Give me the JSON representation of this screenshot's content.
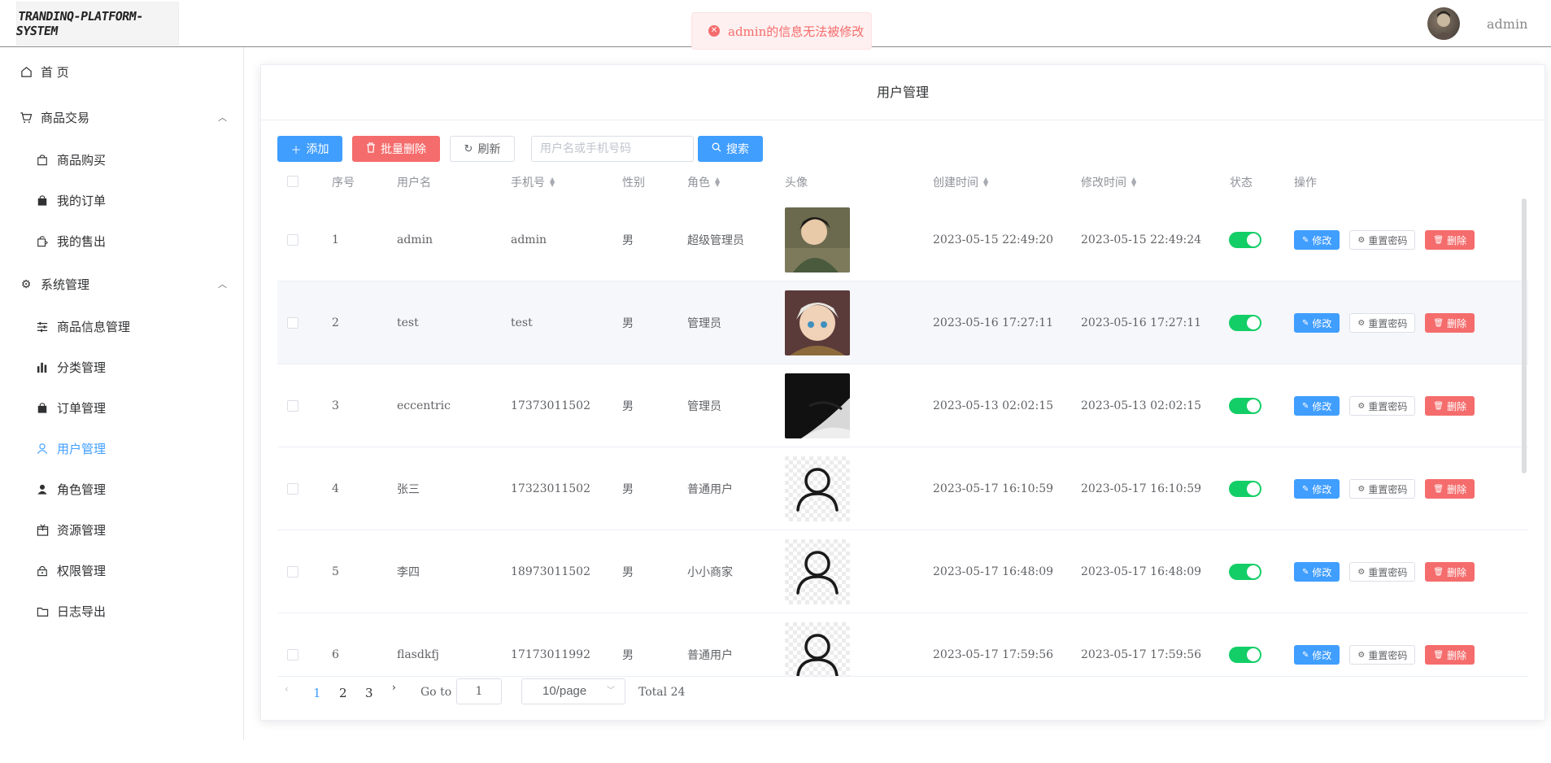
{
  "header": {
    "logo_text": "TRANDINQ-PLATFORM-SYSTEM",
    "username": "admin"
  },
  "toast": {
    "message": "admin的信息无法被修改",
    "icon": "close-circle-icon",
    "color": "#f56c6c"
  },
  "sidebar": {
    "items": [
      {
        "label": "首 页",
        "icon": "home-icon"
      },
      {
        "label": "商品交易",
        "icon": "cart-icon"
      },
      {
        "label": "商品购买",
        "icon": "bag-icon"
      },
      {
        "label": "我的订单",
        "icon": "order-icon"
      },
      {
        "label": "我的售出",
        "icon": "sell-icon"
      },
      {
        "label": "系统管理",
        "icon": "gear-icon"
      },
      {
        "label": "商品信息管理",
        "icon": "sliders-icon"
      },
      {
        "label": "分类管理",
        "icon": "chart-icon"
      },
      {
        "label": "订单管理",
        "icon": "bag-icon"
      },
      {
        "label": "用户管理",
        "icon": "user-icon"
      },
      {
        "label": "角色管理",
        "icon": "user-solid-icon"
      },
      {
        "label": "资源管理",
        "icon": "box-icon"
      },
      {
        "label": "权限管理",
        "icon": "lock-icon"
      },
      {
        "label": "日志导出",
        "icon": "folder-icon"
      }
    ],
    "active": "用户管理",
    "active_color": "#409eff"
  },
  "card": {
    "title": "用户管理"
  },
  "toolbar": {
    "add_label": "添加",
    "batch_delete_label": "批量删除",
    "refresh_label": "刷新",
    "search_placeholder": "用户名或手机号码",
    "search_label": "搜索"
  },
  "table": {
    "headers": {
      "index": "序号",
      "username": "用户名",
      "phone": "手机号",
      "gender": "性别",
      "role": "角色",
      "avatar": "头像",
      "created": "创建时间",
      "modified": "修改时间",
      "status": "状态",
      "actions": "操作"
    },
    "actions": {
      "edit": "修改",
      "reset": "重置密码",
      "delete": "删除"
    },
    "rows": [
      {
        "index": "1",
        "username": "admin",
        "phone": "admin",
        "gender": "男",
        "role": "超级管理员",
        "created": "2023-05-15 22:49:20",
        "modified": "2023-05-15 22:49:24",
        "status": true,
        "avatar": "avatar-photo-1"
      },
      {
        "index": "2",
        "username": "test",
        "phone": "test",
        "gender": "男",
        "role": "管理员",
        "created": "2023-05-16 17:27:11",
        "modified": "2023-05-16 17:27:11",
        "status": true,
        "avatar": "avatar-photo-2"
      },
      {
        "index": "3",
        "username": "eccentric",
        "phone": "17373011502",
        "gender": "男",
        "role": "管理员",
        "created": "2023-05-13 02:02:15",
        "modified": "2023-05-13 02:02:15",
        "status": true,
        "avatar": "avatar-photo-3"
      },
      {
        "index": "4",
        "username": "张三",
        "phone": "17323011502",
        "gender": "男",
        "role": "普通用户",
        "created": "2023-05-17 16:10:59",
        "modified": "2023-05-17 16:10:59",
        "status": true,
        "avatar": "default-user-icon"
      },
      {
        "index": "5",
        "username": "李四",
        "phone": "18973011502",
        "gender": "男",
        "role": "小小商家",
        "created": "2023-05-17 16:48:09",
        "modified": "2023-05-17 16:48:09",
        "status": true,
        "avatar": "default-user-icon"
      },
      {
        "index": "6",
        "username": "flasdkfj",
        "phone": "17173011992",
        "gender": "男",
        "role": "普通用户",
        "created": "2023-05-17 17:59:56",
        "modified": "2023-05-17 17:59:56",
        "status": true,
        "avatar": "default-user-icon"
      }
    ]
  },
  "pagination": {
    "pages": [
      "1",
      "2",
      "3"
    ],
    "current": "1",
    "goto_label": "Go to",
    "goto_value": "1",
    "page_size": "10/page",
    "total": "Total 24"
  },
  "colors": {
    "primary": "#409eff",
    "danger": "#f56c6c",
    "switch_on": "#13ce66"
  }
}
